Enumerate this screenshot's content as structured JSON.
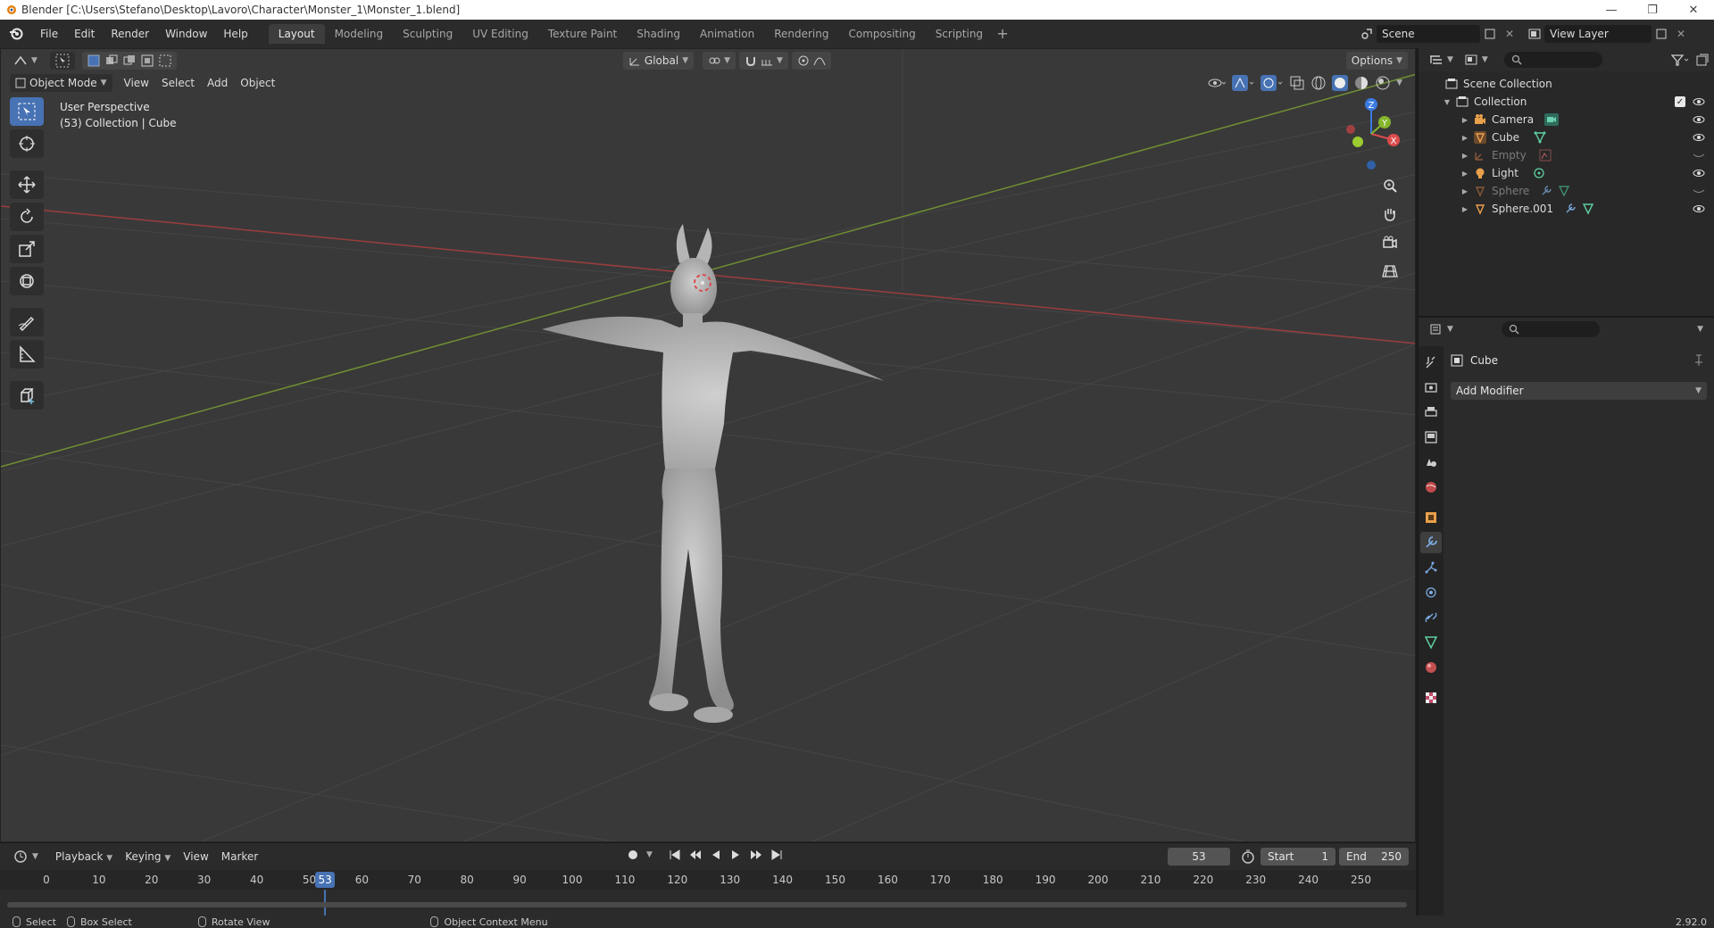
{
  "window": {
    "title": "Blender [C:\\Users\\Stefano\\Desktop\\Lavoro\\Character\\Monster_1\\Monster_1.blend]",
    "controls": [
      "—",
      "❐",
      "✕"
    ]
  },
  "menu": {
    "items": [
      "File",
      "Edit",
      "Render",
      "Window",
      "Help"
    ]
  },
  "workspaces": {
    "tabs": [
      "Layout",
      "Modeling",
      "Sculpting",
      "UV Editing",
      "Texture Paint",
      "Shading",
      "Animation",
      "Rendering",
      "Compositing",
      "Scripting"
    ],
    "active": "Layout",
    "add": "+"
  },
  "scene": {
    "scene_name": "Scene",
    "view_layer": "View Layer"
  },
  "viewport": {
    "transform_orientation": "Global",
    "options_label": "Options",
    "mode": "Object Mode",
    "header_menus": [
      "View",
      "Select",
      "Add",
      "Object"
    ],
    "perspective_label": "User Perspective",
    "collection_label": "(53) Collection | Cube",
    "axis_labels": {
      "x": "X",
      "y": "Y",
      "z": "Z"
    }
  },
  "timeline": {
    "menus": [
      "Playback",
      "Keying",
      "View",
      "Marker"
    ],
    "current_frame": "53",
    "start_label": "Start",
    "start_value": "1",
    "end_label": "End",
    "end_value": "250",
    "ruler": [
      "0",
      "10",
      "20",
      "30",
      "40",
      "50",
      "60",
      "70",
      "80",
      "90",
      "100",
      "110",
      "120",
      "130",
      "140",
      "150",
      "160",
      "170",
      "180",
      "190",
      "200",
      "210",
      "220",
      "230",
      "240",
      "250"
    ],
    "cursor": "53"
  },
  "status": {
    "select": "Select",
    "box_select": "Box Select",
    "rotate_view": "Rotate View",
    "context_menu": "Object Context Menu",
    "version": "2.92.0"
  },
  "outliner": {
    "scene_collection": "Scene Collection",
    "collection": "Collection",
    "items": [
      "Camera",
      "Cube",
      "Empty",
      "Light",
      "Sphere",
      "Sphere.001"
    ]
  },
  "properties": {
    "object_name": "Cube",
    "add_modifier": "Add Modifier"
  },
  "colors": {
    "accent": "#4772b3",
    "x_axis": "#db4c4c",
    "y_axis": "#85b52a",
    "z_axis": "#3b7be0"
  }
}
